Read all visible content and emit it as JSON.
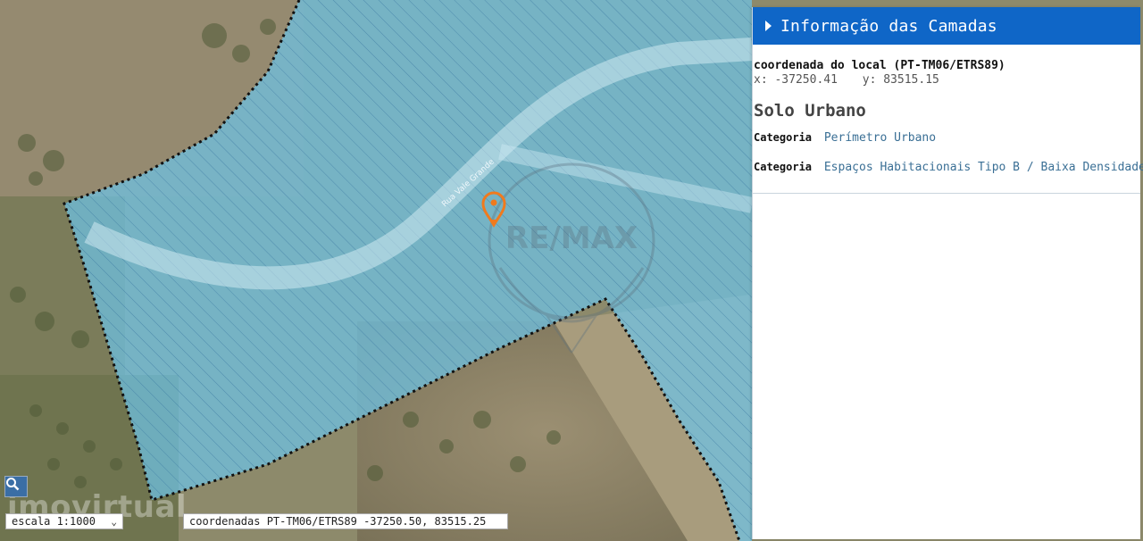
{
  "panel": {
    "title": "Informação das Camadas",
    "coord_title": "coordenada do local (PT-TM06/ETRS89)",
    "coord_x": "x: -37250.41",
    "coord_y": "y: 83515.15",
    "layer_title": "Solo Urbano",
    "categories": [
      {
        "label": "Categoria",
        "value": "Perímetro Urbano"
      },
      {
        "label": "Categoria",
        "value": "Espaços Habitacionais Tipo B / Baixa Densidade"
      }
    ]
  },
  "map": {
    "scale_label": "escala 1:1000",
    "coords_label": "coordenadas PT-TM06/ETRS89 -37250.50, 83515.25",
    "watermark_text": "imovirtual",
    "logo_text": "RE/MAX",
    "street_label": "Rua Vale Grande",
    "area_color": "#6ec3e6",
    "marker_color": "#f07a1e",
    "marker_icon": "location-pin-icon",
    "zoom_icon": "magnifier-icon"
  }
}
